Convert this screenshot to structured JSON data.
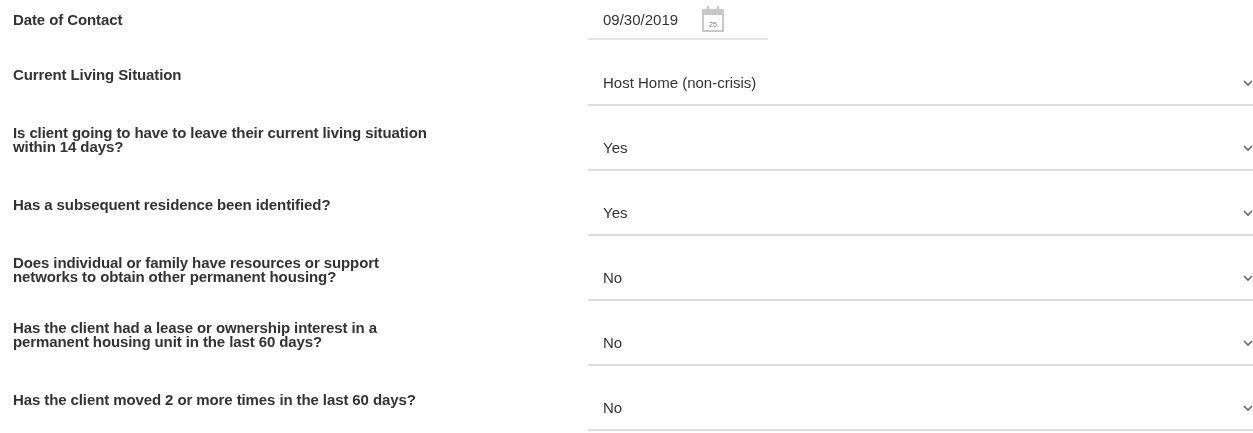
{
  "fields": [
    {
      "kind": "date",
      "label": "Date of Contact",
      "value": "09/30/2019",
      "icon_day": "25"
    },
    {
      "kind": "select",
      "label": "Current Living Situation",
      "value": "Host Home (non-crisis)"
    },
    {
      "kind": "select",
      "label": "Is client going to have to leave their current living situation within 14 days?",
      "value": "Yes"
    },
    {
      "kind": "select",
      "label": "Has a subsequent residence been identified?",
      "value": "Yes"
    },
    {
      "kind": "select",
      "label": "Does individual or family have resources or support networks to obtain other permanent housing?",
      "value": "No"
    },
    {
      "kind": "select",
      "label": "Has the client had a lease or ownership interest in a permanent housing unit in the last 60 days?",
      "value": "No"
    },
    {
      "kind": "select",
      "label": "Has the client moved 2 or more times in the last 60 days?",
      "value": "No"
    }
  ]
}
